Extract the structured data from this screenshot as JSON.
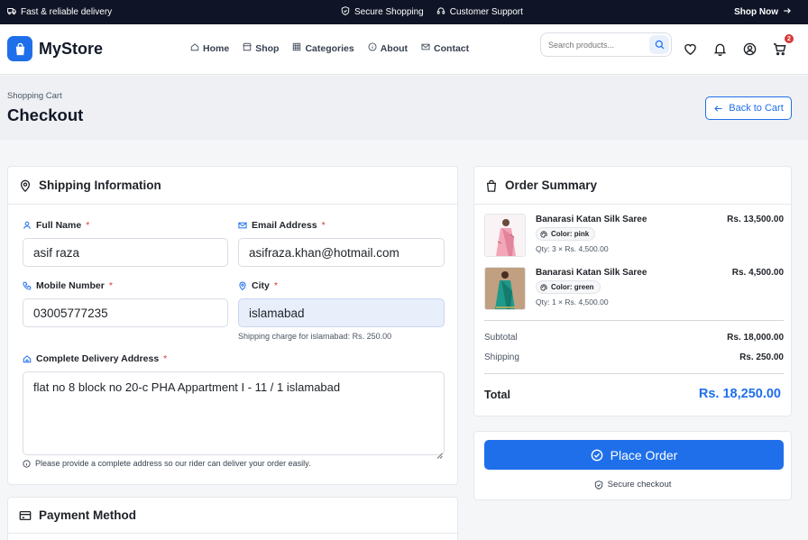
{
  "topbar": {
    "left": "Fast & reliable delivery",
    "secure": "Secure Shopping",
    "support": "Customer Support",
    "cta": "Shop Now"
  },
  "header": {
    "logo": "MyStore",
    "nav": [
      "Home",
      "Shop",
      "Categories",
      "About",
      "Contact"
    ],
    "search_placeholder": "Search products...",
    "cart_count": "2"
  },
  "page": {
    "breadcrumb": "Shopping Cart",
    "title": "Checkout",
    "back_label": "Back to Cart"
  },
  "shipping": {
    "title": "Shipping Information",
    "full_name_label": "Full Name",
    "full_name": "asif raza",
    "email_label": "Email Address",
    "email": "asifraza.khan@hotmail.com",
    "mobile_label": "Mobile Number",
    "mobile": "03005777235",
    "city_label": "City",
    "city": "islamabad",
    "city_hint": "Shipping charge for islamabad: Rs. 250.00",
    "address_label": "Complete Delivery Address",
    "address": "flat no 8 block no 20-c PHA Appartment I - 11 / 1 islamabad",
    "address_note": "Please provide a complete address so our rider can deliver your order easily.",
    "required_mark": "*"
  },
  "payment": {
    "title": "Payment Method"
  },
  "summary": {
    "title": "Order Summary",
    "items": [
      {
        "name": "Banarasi Katan Silk Saree",
        "color": "Color: pink",
        "qty": "Qty: 3 × Rs. 4,500.00",
        "price": "Rs. 13,500.00",
        "swatch": "#f2a6b8"
      },
      {
        "name": "Banarasi Katan Silk Saree",
        "color": "Color: green",
        "qty": "Qty: 1 × Rs. 4,500.00",
        "price": "Rs. 4,500.00",
        "swatch": "#1f9a8a"
      }
    ],
    "subtotal_label": "Subtotal",
    "subtotal": "Rs. 18,000.00",
    "shipping_label": "Shipping",
    "shipping": "Rs. 250.00",
    "total_label": "Total",
    "total": "Rs. 18,250.00"
  },
  "actions": {
    "place_order": "Place Order",
    "secure_checkout": "Secure checkout"
  },
  "colors": {
    "accent": "#1f6feb",
    "topbar": "#0f1526",
    "required": "#d93636"
  }
}
